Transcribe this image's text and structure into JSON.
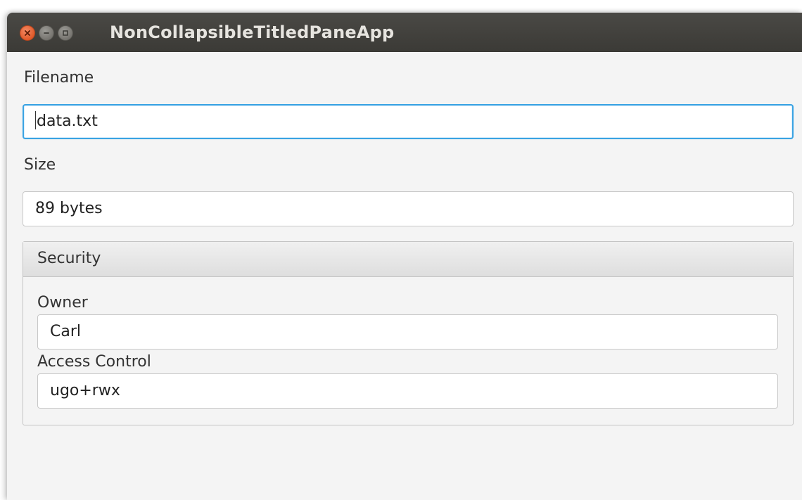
{
  "window": {
    "title": "NonCollapsibleTitledPaneApp"
  },
  "form": {
    "filename": {
      "label": "Filename",
      "value": "data.txt"
    },
    "size": {
      "label": "Size",
      "value": "89 bytes"
    },
    "security": {
      "title": "Security",
      "owner": {
        "label": "Owner",
        "value": "Carl"
      },
      "access_control": {
        "label": "Access Control",
        "value": "ugo+rwx"
      }
    }
  },
  "colors": {
    "titlebar": "#3f3e3a",
    "close_button": "#e6602f",
    "focus_border": "#3aa3e3",
    "background": "#f4f4f4"
  },
  "icons": [
    "close-icon",
    "minimize-icon",
    "maximize-icon"
  ]
}
